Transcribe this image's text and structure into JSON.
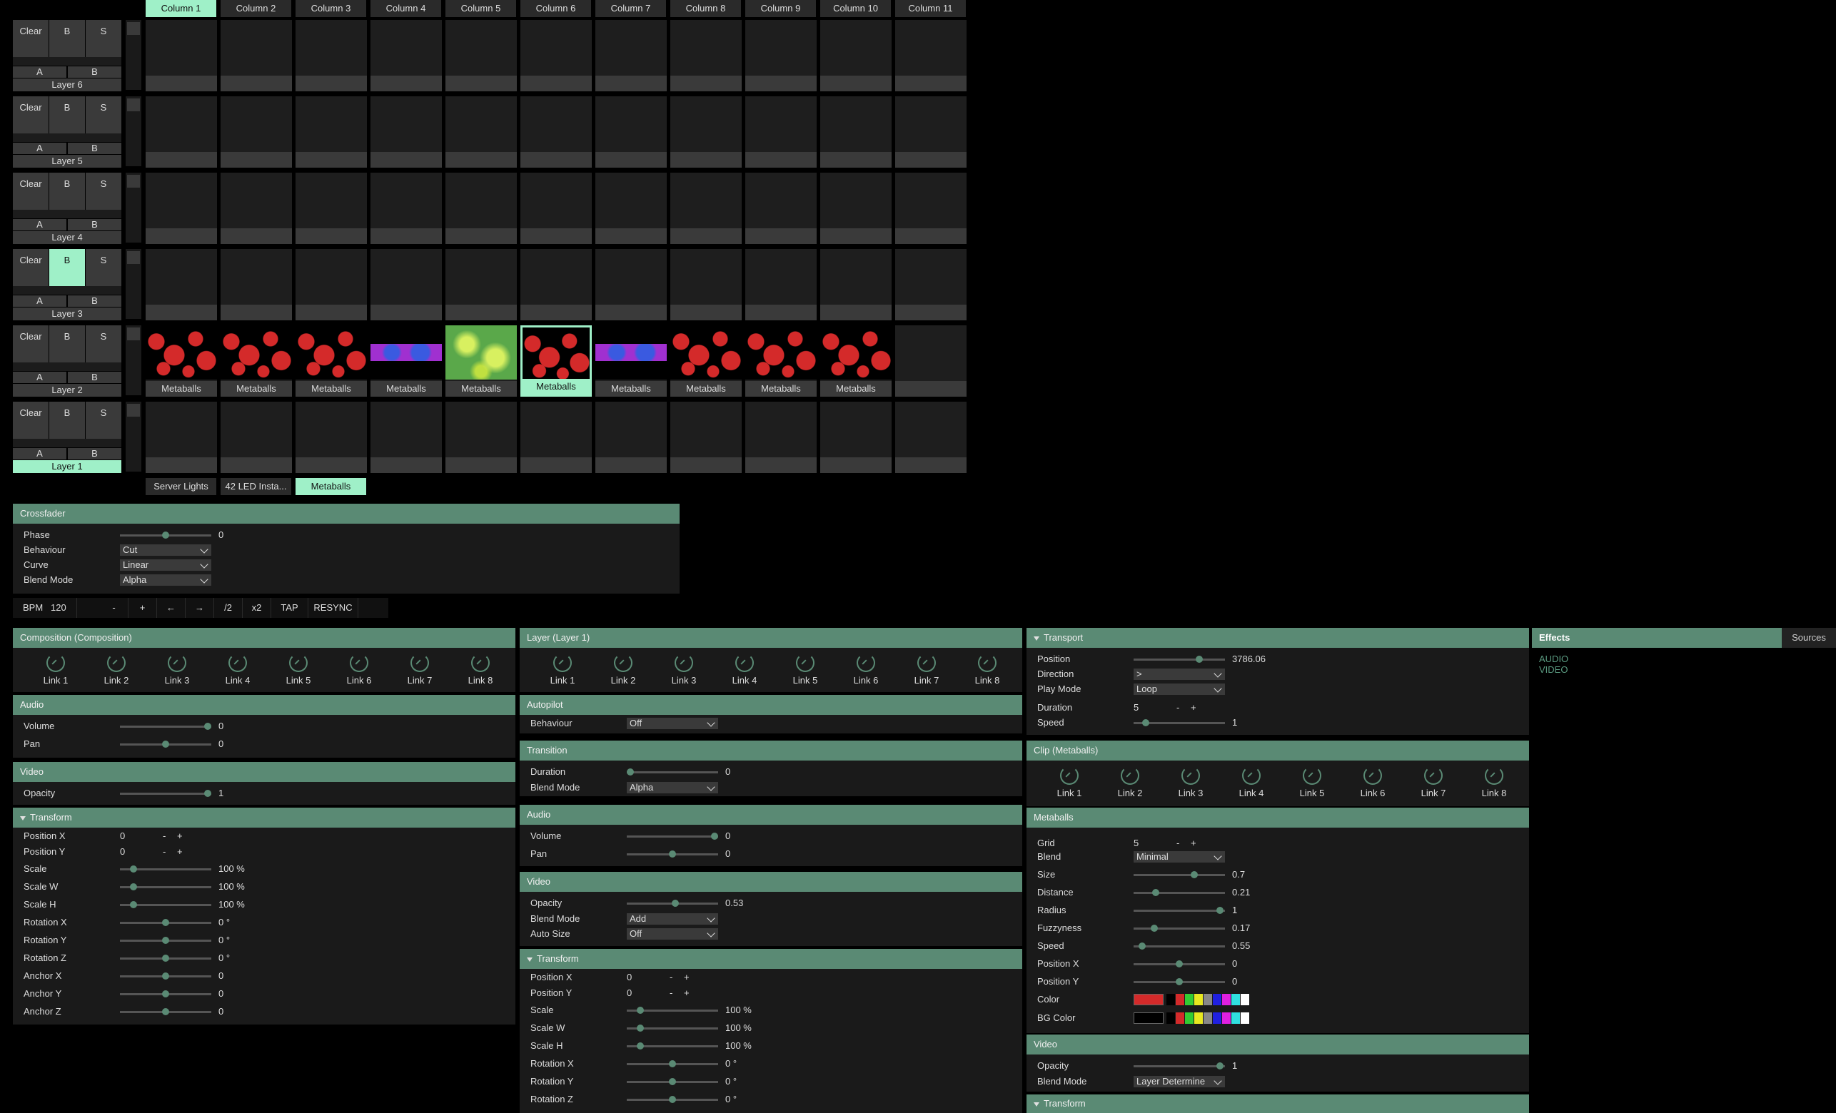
{
  "columns": [
    "Column 1",
    "Column 2",
    "Column 3",
    "Column 4",
    "Column 5",
    "Column 6",
    "Column 7",
    "Column 8",
    "Column 9",
    "Column 10",
    "Column 11"
  ],
  "active_column": 0,
  "layers": [
    {
      "name": "Layer 6",
      "b_on": false,
      "active": false
    },
    {
      "name": "Layer 5",
      "b_on": false,
      "active": false
    },
    {
      "name": "Layer 4",
      "b_on": false,
      "active": false
    },
    {
      "name": "Layer 3",
      "b_on": true,
      "active": false
    },
    {
      "name": "Layer 2",
      "b_on": false,
      "active": false
    },
    {
      "name": "Layer 1",
      "b_on": false,
      "active": true
    }
  ],
  "layer_buttons": {
    "clear": "Clear",
    "b": "B",
    "s": "S",
    "a_label": "A",
    "b_label": "B"
  },
  "clip_label": "Metaballs",
  "decks": [
    "Server Lights",
    "42 LED Insta...",
    "Metaballs"
  ],
  "active_deck": 2,
  "crossfader": {
    "title": "Crossfader",
    "phase_label": "Phase",
    "phase_value": "0",
    "phase_frac": 0.5,
    "behaviour_label": "Behaviour",
    "behaviour_value": "Cut",
    "curve_label": "Curve",
    "curve_value": "Linear",
    "blend_label": "Blend Mode",
    "blend_value": "Alpha"
  },
  "bpm": {
    "label": "BPM",
    "value": "120",
    "buttons": [
      "-",
      "+",
      "←",
      "→",
      "/2",
      "x2",
      "TAP",
      "RESYNC"
    ]
  },
  "composition": {
    "title": "Composition (Composition)",
    "links": [
      "Link 1",
      "Link 2",
      "Link 3",
      "Link 4",
      "Link 5",
      "Link 6",
      "Link 7",
      "Link 8"
    ],
    "audio_title": "Audio",
    "volume_label": "Volume",
    "volume_value": "0",
    "volume_frac": 1.0,
    "pan_label": "Pan",
    "pan_value": "0",
    "pan_frac": 0.5,
    "video_title": "Video",
    "opacity_label": "Opacity",
    "opacity_value": "1",
    "opacity_frac": 1.0,
    "transform_title": "Transform",
    "posx_label": "Position X",
    "posx_value": "0",
    "posy_label": "Position Y",
    "posy_value": "0",
    "rows": [
      {
        "label": "Scale",
        "value": "100 %",
        "frac": 0.12
      },
      {
        "label": "Scale W",
        "value": "100 %",
        "frac": 0.12
      },
      {
        "label": "Scale H",
        "value": "100 %",
        "frac": 0.12
      },
      {
        "label": "Rotation X",
        "value": "0 °",
        "frac": 0.5
      },
      {
        "label": "Rotation Y",
        "value": "0 °",
        "frac": 0.5
      },
      {
        "label": "Rotation Z",
        "value": "0 °",
        "frac": 0.5
      },
      {
        "label": "Anchor X",
        "value": "0",
        "frac": 0.5
      },
      {
        "label": "Anchor Y",
        "value": "0",
        "frac": 0.5
      },
      {
        "label": "Anchor Z",
        "value": "0",
        "frac": 0.5
      }
    ]
  },
  "layer": {
    "title": "Layer (Layer 1)",
    "links": [
      "Link 1",
      "Link 2",
      "Link 3",
      "Link 4",
      "Link 5",
      "Link 6",
      "Link 7",
      "Link 8"
    ],
    "autopilot_title": "Autopilot",
    "behaviour_label": "Behaviour",
    "behaviour_value": "Off",
    "transition_title": "Transition",
    "duration_label": "Duration",
    "duration_value": "0",
    "duration_frac": 0.0,
    "tblend_label": "Blend Mode",
    "tblend_value": "Alpha",
    "audio_title": "Audio",
    "volume_label": "Volume",
    "volume_value": "0",
    "volume_frac": 1.0,
    "pan_label": "Pan",
    "pan_value": "0",
    "pan_frac": 0.5,
    "video_title": "Video",
    "opacity_label": "Opacity",
    "opacity_value": "0.53",
    "opacity_frac": 0.53,
    "vblend_label": "Blend Mode",
    "vblend_value": "Add",
    "autosize_label": "Auto Size",
    "autosize_value": "Off",
    "transform_title": "Transform",
    "posx_label": "Position X",
    "posx_value": "0",
    "posy_label": "Position Y",
    "posy_value": "0",
    "rows": [
      {
        "label": "Scale",
        "value": "100 %",
        "frac": 0.12
      },
      {
        "label": "Scale W",
        "value": "100 %",
        "frac": 0.12
      },
      {
        "label": "Scale H",
        "value": "100 %",
        "frac": 0.12
      },
      {
        "label": "Rotation X",
        "value": "0 °",
        "frac": 0.5
      },
      {
        "label": "Rotation Y",
        "value": "0 °",
        "frac": 0.5
      },
      {
        "label": "Rotation Z",
        "value": "0 °",
        "frac": 0.5
      }
    ]
  },
  "transport": {
    "title": "Transport",
    "position_label": "Position",
    "position_value": "3786.06",
    "position_frac": 0.74,
    "direction_label": "Direction",
    "direction_value": ">",
    "playmode_label": "Play Mode",
    "playmode_value": "Loop",
    "duration_label": "Duration",
    "duration_value": "5",
    "speed_label": "Speed",
    "speed_value": "1",
    "speed_frac": 0.1
  },
  "clip": {
    "title": "Clip (Metaballs)",
    "links": [
      "Link 1",
      "Link 2",
      "Link 3",
      "Link 4",
      "Link 5",
      "Link 6",
      "Link 7",
      "Link 8"
    ]
  },
  "metaballs": {
    "title": "Metaballs",
    "grid_label": "Grid",
    "grid_value": "5",
    "blend_label": "Blend",
    "blend_value": "Minimal",
    "rows": [
      {
        "label": "Size",
        "value": "0.7",
        "frac": 0.68
      },
      {
        "label": "Distance",
        "value": "0.21",
        "frac": 0.22
      },
      {
        "label": "Radius",
        "value": "1",
        "frac": 0.98
      },
      {
        "label": "Fuzzyness",
        "value": "0.17",
        "frac": 0.2
      },
      {
        "label": "Speed",
        "value": "0.55",
        "frac": 0.06
      },
      {
        "label": "Position X",
        "value": "0",
        "frac": 0.5
      },
      {
        "label": "Position Y",
        "value": "0",
        "frac": 0.5
      }
    ],
    "color_label": "Color",
    "bgcolor_label": "BG Color",
    "color_main": "#d42a2a",
    "bgcolor_main": "#000000",
    "palette": [
      "#000000",
      "#d42a2a",
      "#33cc33",
      "#e8e820",
      "#888888",
      "#2020e0",
      "#e020e0",
      "#30e0e0",
      "#ffffff"
    ]
  },
  "clip_video": {
    "title": "Video",
    "opacity_label": "Opacity",
    "opacity_value": "1",
    "opacity_frac": 0.98,
    "blend_label": "Blend Mode",
    "blend_value": "Layer Determine",
    "transform_title": "Transform"
  },
  "effects": {
    "tab_effects": "Effects",
    "tab_sources": "Sources",
    "items": [
      "AUDIO",
      "VIDEO"
    ]
  },
  "colors": {
    "accent": "#9ff0c8",
    "header": "#5a8a74"
  }
}
